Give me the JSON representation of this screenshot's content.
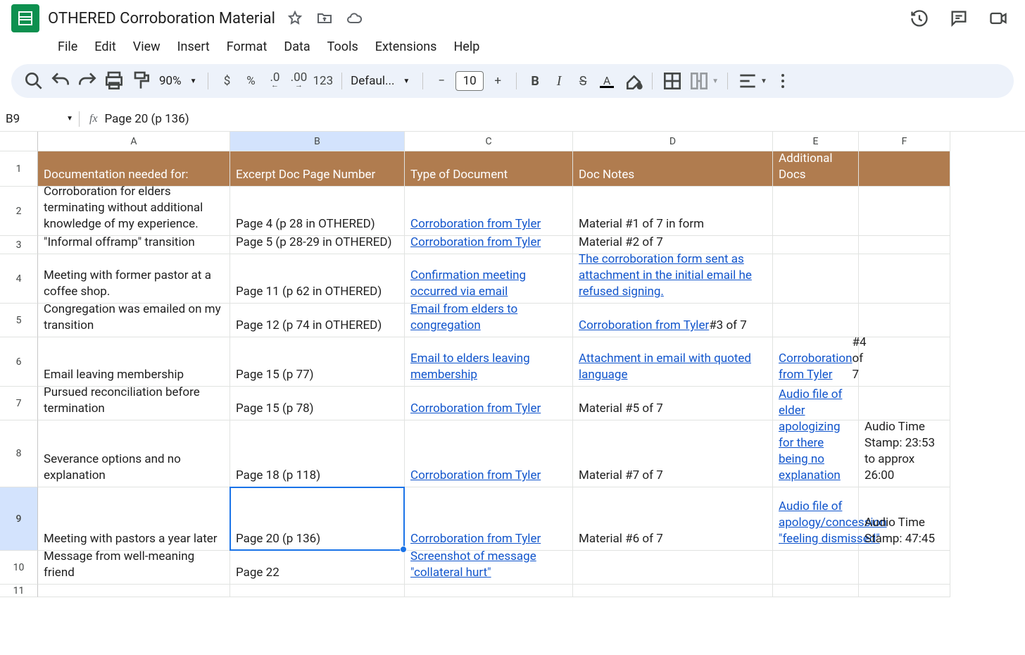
{
  "doc": {
    "title": "OTHERED Corroboration Material"
  },
  "menubar": [
    "File",
    "Edit",
    "View",
    "Insert",
    "Format",
    "Data",
    "Tools",
    "Extensions",
    "Help"
  ],
  "toolbar": {
    "zoom": "90%",
    "font": "Defaul...",
    "size": "10",
    "dollar": "$",
    "percent": "%",
    "dec_dec": ".0",
    "dec_inc": ".00",
    "num123": "123",
    "minus": "−",
    "plus": "+",
    "bold": "B",
    "italic": "I",
    "strike": "S",
    "textcolor": "A"
  },
  "namebox": {
    "cell": "B9",
    "formula": "Page 20 (p 136)"
  },
  "columns": [
    "A",
    "B",
    "C",
    "D",
    "E",
    "F"
  ],
  "selectedCol": "B",
  "selectedRow": "9",
  "headers": {
    "A": "Documentation needed for:",
    "B": "Excerpt Doc Page Number",
    "C": "Type of Document",
    "D": "Doc Notes",
    "E": "Additional Docs",
    "F": ""
  },
  "rows": [
    {
      "n": "1"
    },
    {
      "n": "2",
      "A": "Corroboration for elders terminating without additional knowledge of my experience.",
      "B": "Page 4 (p 28 in OTHERED)",
      "C": {
        "text": "Corroboration from Tyler",
        "link": true
      },
      "D": "Material #1 of 7 in form",
      "E": "",
      "F": ""
    },
    {
      "n": "3",
      "A": "\"Informal offramp\" transition",
      "B": "Page 5 (p 28-29 in OTHERED)",
      "C": {
        "text": "Corroboration from Tyler",
        "link": true
      },
      "D": "Material #2 of 7",
      "E": "",
      "F": ""
    },
    {
      "n": "4",
      "A": "Meeting with former pastor at a coffee shop.",
      "B": "Page 11 (p 62 in OTHERED)",
      "C": {
        "text": "Confirmation meeting occurred via email",
        "link": true
      },
      "D": {
        "text": "The corroboration form sent as attachment in the initial email he refused signing.",
        "link": true
      },
      "E": "",
      "F": ""
    },
    {
      "n": "5",
      "A": "Congregation was emailed on my transition",
      "B": "Page 12 (p 74 in OTHERED)",
      "C": {
        "text": "Email from elders to congregation",
        "link": true
      },
      "D": {
        "html": true,
        "pre": "",
        "linkText": "Corroboration from Tyler",
        "post": " #3 of 7"
      },
      "E": "",
      "F": ""
    },
    {
      "n": "6",
      "A": "Email leaving membership",
      "B": "Page 15 (p 77)",
      "C": {
        "text": "Email to elders leaving membership",
        "link": true
      },
      "D": {
        "text": "Attachment in email with quoted language",
        "link": true
      },
      "E": {
        "html": true,
        "pre": "",
        "linkText": "Corroboration from Tyler",
        "post": " #4 of 7"
      },
      "F": ""
    },
    {
      "n": "7",
      "A": "Pursued reconciliation before termination",
      "B": "Page 15 (p 78)",
      "C": {
        "text": "Corroboration from Tyler",
        "link": true
      },
      "D": "Material #5 of 7",
      "E": "",
      "F": ""
    },
    {
      "n": "8",
      "A": "Severance options and no explanation",
      "B": "Page 18 (p 118)",
      "C": {
        "text": "Corroboration from Tyler",
        "link": true
      },
      "D": "Material #7 of 7",
      "E": {
        "text": "Audio file of elder apologizing for there being no explanation",
        "link": true
      },
      "F": "Audio Time Stamp: 23:53 to approx 26:00"
    },
    {
      "n": "9",
      "A": "Meeting with pastors a year later",
      "B": "Page 20 (p 136)",
      "C": {
        "text": "Corroboration from Tyler",
        "link": true
      },
      "D": "Material #6 of 7",
      "E": {
        "text": "Audio file of apology/concession \"feeling dismissed\"",
        "link": true
      },
      "F": "Audio Time Stamp: 47:45"
    },
    {
      "n": "10",
      "A": "Message from well-meaning friend",
      "B": "Page 22",
      "C": {
        "text": "Screenshot of message \"collateral hurt\"",
        "link": true
      },
      "D": "",
      "E": "",
      "F": ""
    },
    {
      "n": "11"
    }
  ]
}
